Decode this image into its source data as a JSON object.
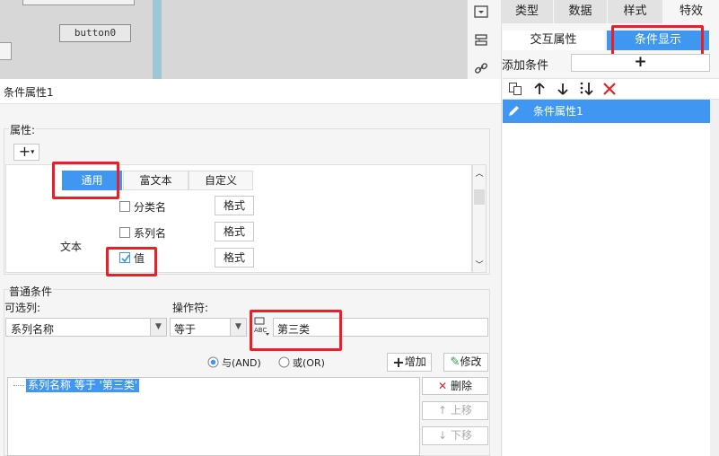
{
  "canvas": {
    "button_label": "button0"
  },
  "right_tabs": [
    {
      "label": "类型"
    },
    {
      "label": "数据"
    },
    {
      "label": "样式"
    },
    {
      "label": "特效"
    }
  ],
  "right_subtabs": [
    {
      "label": "交互属性"
    },
    {
      "label": "条件显示"
    }
  ],
  "add_condition": {
    "label": "添加条件",
    "plus": "+"
  },
  "condition_list": {
    "items": [
      "条件属性1"
    ]
  },
  "dialog": {
    "title": "条件属性1",
    "properties": {
      "label": "属性:",
      "add_btn": "+",
      "tabs": [
        "通用",
        "富文本",
        "自定义"
      ],
      "text_label": "文本",
      "rows": [
        {
          "label": "分类名",
          "checked": false,
          "format": "格式"
        },
        {
          "label": "系列名",
          "checked": false,
          "format": "格式"
        },
        {
          "label": "值",
          "checked": true,
          "format": "格式"
        }
      ]
    },
    "normal_condition": {
      "title": "普通条件",
      "col_label": "可选列:",
      "col_value": "系列名称",
      "op_label": "操作符:",
      "op_value": "等于",
      "value_input": "第三类",
      "and_label": "与(AND)",
      "or_label": "或(OR)",
      "add_btn": "增加",
      "edit_btn": "修改",
      "condition_item": "系列名称 等于 '第三类'",
      "delete_btn": "删除",
      "up_btn": "上移",
      "down_btn": "下移"
    }
  },
  "colors": {
    "accent": "#3f97f2",
    "highlight": "#e8202a"
  }
}
